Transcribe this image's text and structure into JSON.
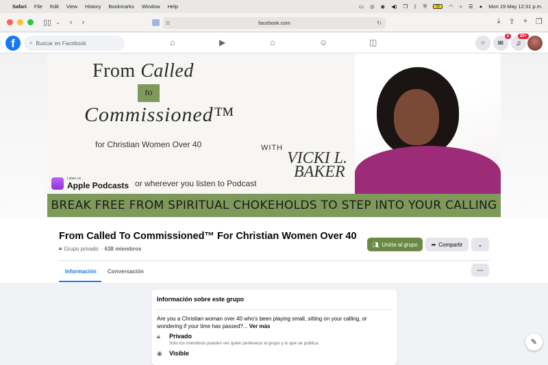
{
  "menubar": {
    "app": "Safari",
    "items": [
      "File",
      "Edit",
      "View",
      "History",
      "Bookmarks",
      "Window",
      "Help"
    ],
    "datetime": "Mon 19 May  12:31 p.m.",
    "battery": "93"
  },
  "browser": {
    "url": "facebook.com"
  },
  "facebook": {
    "search_placeholder": "Buscar en Facebook",
    "messenger_badge": "2",
    "notifications_badge": "20+"
  },
  "cover": {
    "line1a": "From ",
    "line1b": "Called",
    "to": "to",
    "line2": "Commissioned™",
    "line3": "for Christian Women Over 40",
    "with": "WITH",
    "signature1": "VICKI L.",
    "signature2": "BAKER",
    "podcast_small": "Listen on",
    "podcast_big": "Apple Podcasts",
    "podcast_where": "or wherever you listen to Podcast",
    "banner": "BREAK FREE FROM SPIRITUAL CHOKEHOLDS TO STEP INTO YOUR CALLING"
  },
  "group": {
    "title": "From Called To Commissioned™ For Christian Women Over 40",
    "privacy": "Grupo privado",
    "members": "638 miembros",
    "join": "Unirte al grupo",
    "share": "Compartir"
  },
  "tabs": [
    "Información",
    "Conversación"
  ],
  "about": {
    "heading": "Información sobre este grupo",
    "description": "Are you a Christian woman over 40 who's been playing small, sitting on your calling, or wondering if your time has passed?...",
    "see_more": "Ver más",
    "private_title": "Privado",
    "private_sub": "Solo los miembros pueden ver quién pertenece al grupo y lo que se publica.",
    "visible_title": "Visible"
  }
}
